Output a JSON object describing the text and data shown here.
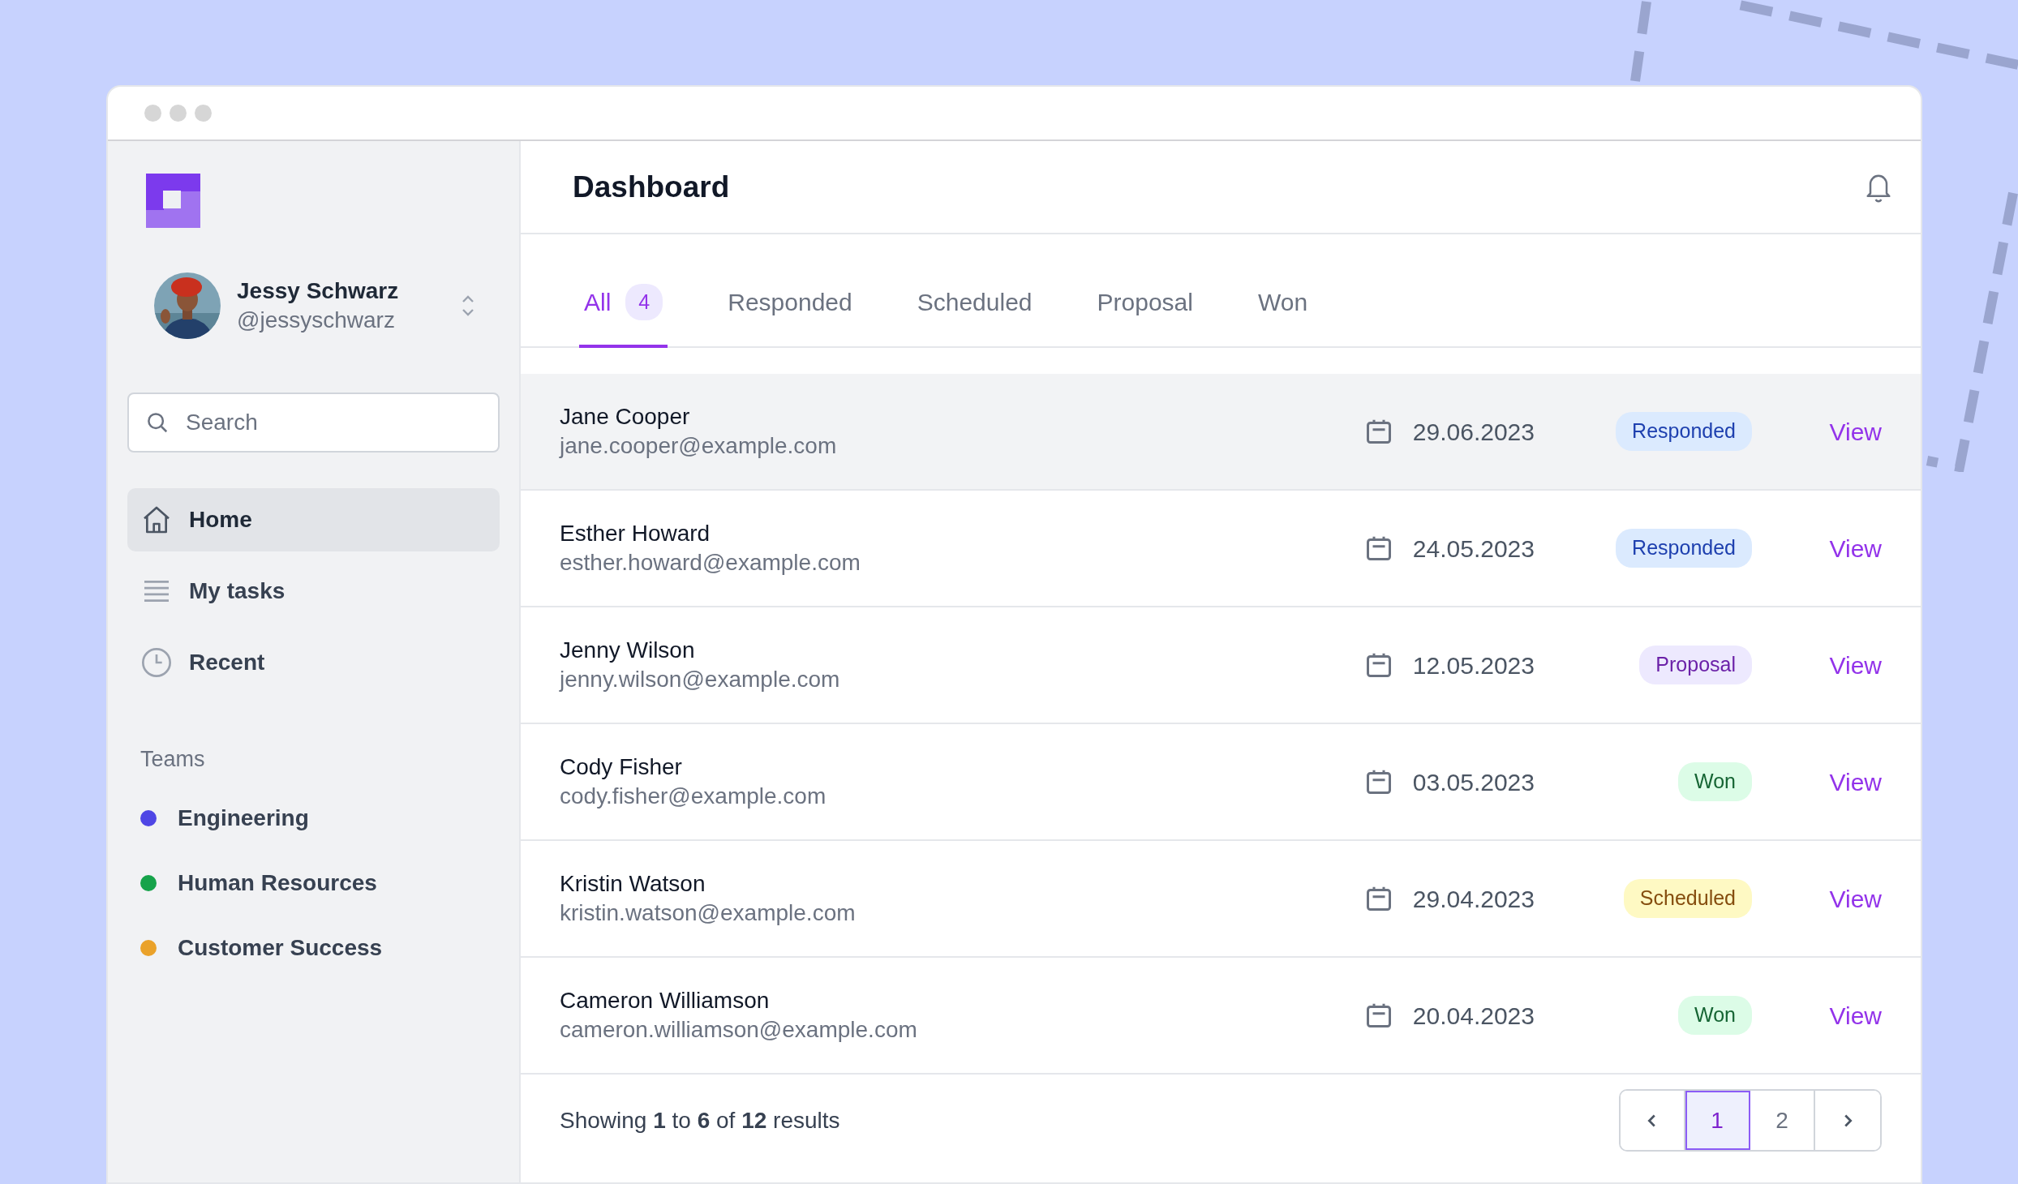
{
  "sidebar": {
    "user": {
      "name": "Jessy Schwarz",
      "handle": "@jessyschwarz"
    },
    "search": {
      "placeholder": "Search"
    },
    "items": [
      {
        "label": "Home",
        "kind": "home",
        "selected": true
      },
      {
        "label": "My tasks",
        "kind": "list",
        "selected": false
      },
      {
        "label": "Recent",
        "kind": "clock",
        "selected": false
      }
    ],
    "teams_heading": "Teams",
    "teams": [
      {
        "label": "Engineering",
        "color": "#4f46e5"
      },
      {
        "label": "Human Resources",
        "color": "#16a34a"
      },
      {
        "label": "Customer Success",
        "color": "#eaa22a"
      }
    ]
  },
  "header": {
    "title": "Dashboard"
  },
  "tabs": [
    {
      "label": "All",
      "count": "4",
      "selected": true
    },
    {
      "label": "Responded",
      "selected": false
    },
    {
      "label": "Scheduled",
      "selected": false
    },
    {
      "label": "Proposal",
      "selected": false
    },
    {
      "label": "Won",
      "selected": false
    }
  ],
  "rows": [
    {
      "name": "Jane Cooper",
      "email": "jane.cooper@example.com",
      "date": "29.06.2023",
      "status": {
        "label": "Responded",
        "kind": "responded"
      },
      "action": "View",
      "selected": true
    },
    {
      "name": "Esther Howard",
      "email": "esther.howard@example.com",
      "date": "24.05.2023",
      "status": {
        "label": "Responded",
        "kind": "responded"
      },
      "action": "View",
      "selected": false
    },
    {
      "name": "Jenny Wilson",
      "email": "jenny.wilson@example.com",
      "date": "12.05.2023",
      "status": {
        "label": "Proposal",
        "kind": "proposal"
      },
      "action": "View",
      "selected": false
    },
    {
      "name": "Cody Fisher",
      "email": "cody.fisher@example.com",
      "date": "03.05.2023",
      "status": {
        "label": "Won",
        "kind": "won"
      },
      "action": "View",
      "selected": false
    },
    {
      "name": "Kristin Watson",
      "email": "kristin.watson@example.com",
      "date": "29.04.2023",
      "status": {
        "label": "Scheduled",
        "kind": "scheduled"
      },
      "action": "View",
      "selected": false
    },
    {
      "name": "Cameron Williamson",
      "email": "cameron.williamson@example.com",
      "date": "20.04.2023",
      "status": {
        "label": "Won",
        "kind": "won"
      },
      "action": "View",
      "selected": false
    }
  ],
  "footer": {
    "summary": "Showing **1** to **6** of **12** results",
    "pages": [
      {
        "label": "1",
        "selected": true
      },
      {
        "label": "2",
        "selected": false
      }
    ]
  }
}
